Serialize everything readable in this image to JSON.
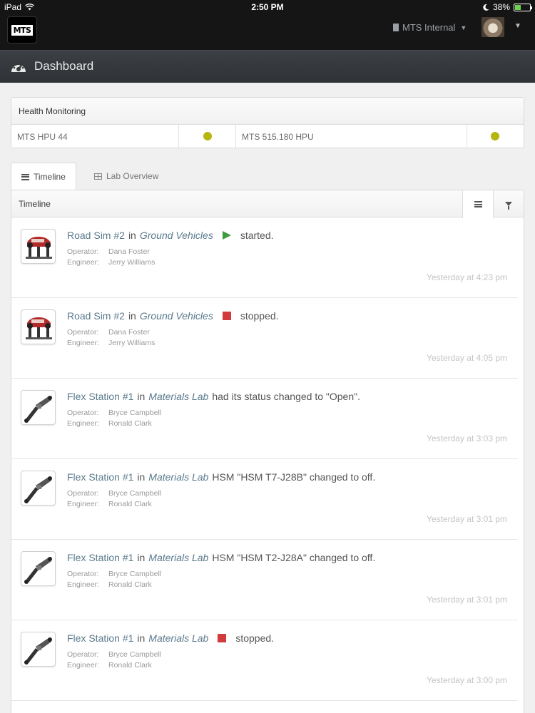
{
  "status_bar": {
    "device": "iPad",
    "time": "2:50 PM",
    "battery": "38%",
    "battery_level": 0.38
  },
  "app_bar": {
    "logo_text": "MTS",
    "org_name": "MTS Internal"
  },
  "dashboard": {
    "title": "Dashboard"
  },
  "health": {
    "title": "Health Monitoring",
    "items": [
      {
        "name": "MTS HPU 44",
        "status_color": "#b5b50e"
      },
      {
        "name": "MTS 515.180 HPU",
        "status_color": "#b5b50e"
      }
    ]
  },
  "tabs": [
    {
      "label": "Timeline",
      "active": true
    },
    {
      "label": "Lab Overview",
      "active": false
    }
  ],
  "timeline": {
    "title": "Timeline",
    "operator_label": "Operator:",
    "engineer_label": "Engineer:",
    "entries": [
      {
        "station": "Road Sim #2",
        "in": "in",
        "lab": "Ground Vehicles",
        "icon": "play-icon",
        "message": "started.",
        "operator": "Dana Foster",
        "engineer": "Jerry Williams",
        "time": "Yesterday at 4:23 pm",
        "thumb": "road-sim"
      },
      {
        "station": "Road Sim #2",
        "in": "in",
        "lab": "Ground Vehicles",
        "icon": "stop-icon",
        "message": "stopped.",
        "operator": "Dana Foster",
        "engineer": "Jerry Williams",
        "time": "Yesterday at 4:05 pm",
        "thumb": "road-sim"
      },
      {
        "station": "Flex Station #1",
        "in": "in",
        "lab": "Materials Lab",
        "icon": "",
        "message": "had its status changed to \"Open\".",
        "operator": "Bryce Campbell",
        "engineer": "Ronald Clark",
        "time": "Yesterday at 3:03 pm",
        "thumb": "flex"
      },
      {
        "station": "Flex Station #1",
        "in": "in",
        "lab": "Materials Lab",
        "icon": "",
        "message": "HSM \"HSM T7-J28B\" changed to off.",
        "operator": "Bryce Campbell",
        "engineer": "Ronald Clark",
        "time": "Yesterday at 3:01 pm",
        "thumb": "flex"
      },
      {
        "station": "Flex Station #1",
        "in": "in",
        "lab": "Materials Lab",
        "icon": "",
        "message": "HSM \"HSM T2-J28A\" changed to off.",
        "operator": "Bryce Campbell",
        "engineer": "Ronald Clark",
        "time": "Yesterday at 3:01 pm",
        "thumb": "flex"
      },
      {
        "station": "Flex Station #1",
        "in": "in",
        "lab": "Materials Lab",
        "icon": "stop-icon",
        "message": "stopped.",
        "operator": "Bryce Campbell",
        "engineer": "Ronald Clark",
        "time": "Yesterday at 3:00 pm",
        "thumb": "flex"
      }
    ]
  },
  "colors": {
    "accent_link": "#5a7a8c",
    "start_green": "#3f9b3f",
    "stop_red": "#d13b3b",
    "health_ok": "#b5b50e"
  }
}
